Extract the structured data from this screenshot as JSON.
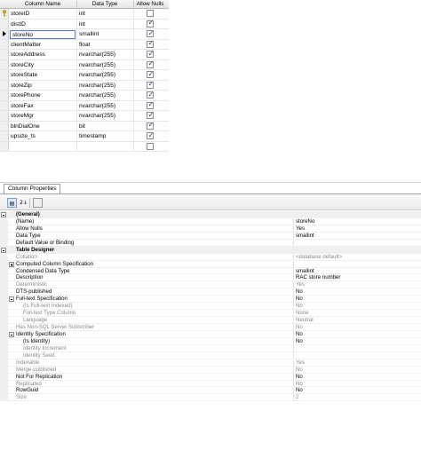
{
  "grid": {
    "headers": [
      "Column Name",
      "Data Type",
      "Allow Nulls"
    ],
    "rows": [
      {
        "name": "storeID",
        "type": "int",
        "nulls": false,
        "key": true
      },
      {
        "name": "distID",
        "type": "int",
        "nulls": true
      },
      {
        "name": "storeNo",
        "type": "smallint",
        "nulls": true,
        "active": true
      },
      {
        "name": "clientMatter",
        "type": "float",
        "nulls": true
      },
      {
        "name": "storeAddress",
        "type": "nvarchar(255)",
        "nulls": true
      },
      {
        "name": "storeCity",
        "type": "nvarchar(255)",
        "nulls": true
      },
      {
        "name": "storeState",
        "type": "nvarchar(255)",
        "nulls": true
      },
      {
        "name": "storeZip",
        "type": "nvarchar(255)",
        "nulls": true
      },
      {
        "name": "storePhone",
        "type": "nvarchar(255)",
        "nulls": true
      },
      {
        "name": "storeFax",
        "type": "nvarchar(255)",
        "nulls": true
      },
      {
        "name": "storeMgr",
        "type": "nvarchar(255)",
        "nulls": true
      },
      {
        "name": "blnDialOne",
        "type": "bit",
        "nulls": true
      },
      {
        "name": "upsize_ts",
        "type": "timestamp",
        "nulls": true
      },
      {
        "name": "",
        "type": "",
        "nulls": false
      }
    ]
  },
  "props": {
    "tab_label": "Column Properties",
    "toolbar": {
      "categorized_icon": "categorized-icon",
      "alpha_icon": "alphabetical-sort-icon",
      "pages_icon": "property-pages-icon",
      "alpha_glyph": "2↓"
    },
    "rows": [
      {
        "kind": "cat",
        "exp": "minus",
        "name": "(General)",
        "value": ""
      },
      {
        "kind": "",
        "name": "(Name)",
        "value": "storeNo"
      },
      {
        "kind": "",
        "name": "Allow Nulls",
        "value": "Yes"
      },
      {
        "kind": "",
        "name": "Data Type",
        "value": "smallint"
      },
      {
        "kind": "",
        "name": "Default Value or Binding",
        "value": ""
      },
      {
        "kind": "cat",
        "exp": "minus",
        "name": "Table Designer",
        "value": ""
      },
      {
        "kind": "ro",
        "name": "Collation",
        "value": "<database default>"
      },
      {
        "kind": "",
        "exp": "plus",
        "name": "Computed Column Specification",
        "value": ""
      },
      {
        "kind": "",
        "name": "Condensed Data Type",
        "value": "smallint"
      },
      {
        "kind": "",
        "name": "Description",
        "value": "RAC store number"
      },
      {
        "kind": "ro",
        "name": "Deterministic",
        "value": "Yes"
      },
      {
        "kind": "",
        "name": "DTS-published",
        "value": "No"
      },
      {
        "kind": "",
        "exp": "minus",
        "name": "Full-text Specification",
        "value": "No"
      },
      {
        "kind": "ro sub",
        "name": "(Is Full-text Indexed)",
        "value": "No"
      },
      {
        "kind": "ro sub",
        "name": "Full-text Type Column",
        "value": "None"
      },
      {
        "kind": "ro sub",
        "name": "Language",
        "value": "Neutral"
      },
      {
        "kind": "ro",
        "name": "Has Non-SQL Server Subscriber",
        "value": "No"
      },
      {
        "kind": "",
        "exp": "minus",
        "name": "Identity Specification",
        "value": "No"
      },
      {
        "kind": "sub",
        "name": "(Is Identity)",
        "value": "No"
      },
      {
        "kind": "ro sub",
        "name": "Identity Increment",
        "value": ""
      },
      {
        "kind": "ro sub",
        "name": "Identity Seed",
        "value": ""
      },
      {
        "kind": "ro",
        "name": "Indexable",
        "value": "Yes"
      },
      {
        "kind": "ro",
        "name": "Merge-published",
        "value": "No"
      },
      {
        "kind": "",
        "name": "Not For Replication",
        "value": "No"
      },
      {
        "kind": "ro",
        "name": "Replicated",
        "value": "No"
      },
      {
        "kind": "",
        "name": "RowGuid",
        "value": "No"
      },
      {
        "kind": "ro",
        "name": "Size",
        "value": "2"
      }
    ]
  }
}
